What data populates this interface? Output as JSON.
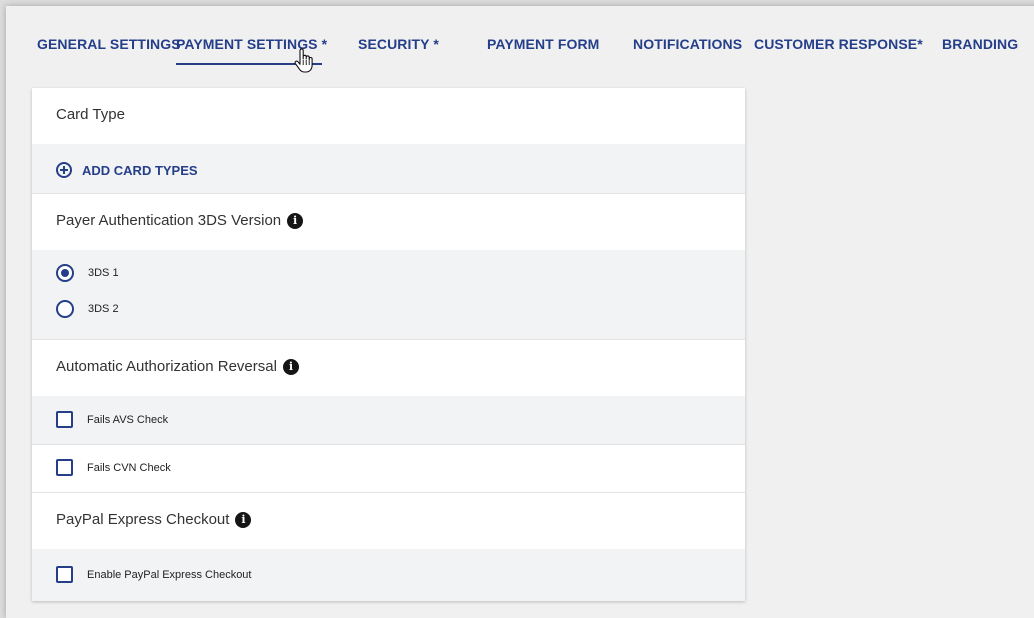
{
  "tabs": [
    {
      "label": "GENERAL SETTINGS"
    },
    {
      "label": "PAYMENT SETTINGS *",
      "active": true
    },
    {
      "label": "SECURITY *"
    },
    {
      "label": "PAYMENT FORM"
    },
    {
      "label": "NOTIFICATIONS"
    },
    {
      "label": "CUSTOMER RESPONSE*"
    },
    {
      "label": "BRANDING"
    }
  ],
  "card_type": {
    "title": "Card Type",
    "add_label": "ADD CARD TYPES"
  },
  "payer_auth": {
    "title": "Payer Authentication 3DS Version",
    "options": [
      {
        "label": "3DS 1",
        "selected": true
      },
      {
        "label": "3DS 2",
        "selected": false
      }
    ]
  },
  "auto_reversal": {
    "title": "Automatic Authorization Reversal",
    "options": [
      {
        "label": "Fails AVS Check",
        "checked": false
      },
      {
        "label": "Fails CVN Check",
        "checked": false
      }
    ]
  },
  "paypal": {
    "title": "PayPal Express Checkout",
    "options": [
      {
        "label": "Enable PayPal Express Checkout",
        "checked": false
      }
    ]
  },
  "colors": {
    "accent": "#253e8a",
    "shade": "#f2f3f5"
  }
}
